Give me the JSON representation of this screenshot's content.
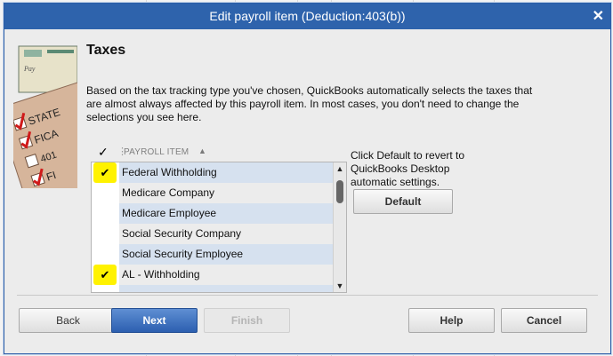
{
  "window": {
    "title": "Edit payroll item (Deduction:403(b))"
  },
  "page": {
    "heading": "Taxes",
    "description": "Based on the tax tracking type you've chosen, QuickBooks automatically selects the taxes that are almost always affected by this payroll item.  In most cases, you don't need to change the selections you see here."
  },
  "hero_image": {
    "labels": [
      "STATE",
      "FICA",
      "401",
      "FI",
      "Pay"
    ]
  },
  "list": {
    "header_check": "✓",
    "column_header": "PAYROLL ITEM",
    "sort_icon": "triangle-up-icon",
    "items": [
      {
        "label": "Federal Withholding",
        "checked": true,
        "highlighted": true
      },
      {
        "label": "Medicare Company",
        "checked": false
      },
      {
        "label": "Medicare Employee",
        "checked": false
      },
      {
        "label": "Social Security Company",
        "checked": false
      },
      {
        "label": "Social Security Employee",
        "checked": false
      },
      {
        "label": "AL - Withholding",
        "checked": true,
        "highlighted": true
      },
      {
        "label": "",
        "checked": false
      }
    ]
  },
  "hint": "Click Default to revert to QuickBooks Desktop automatic settings.",
  "buttons": {
    "default": "Default",
    "back": "Back",
    "next": "Next",
    "finish": "Finish",
    "help": "Help",
    "cancel": "Cancel"
  },
  "colors": {
    "titlebar": "#2e63ac",
    "row_band": "#d6e1ef",
    "highlight": "#fff200",
    "next_button": "#2c5fb0"
  }
}
